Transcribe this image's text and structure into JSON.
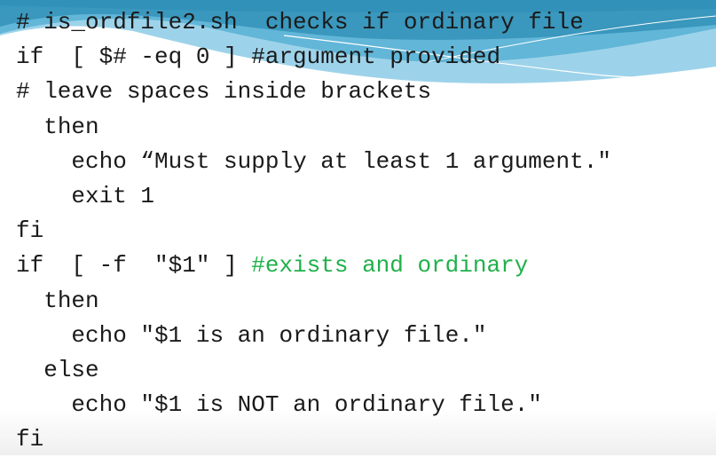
{
  "slide": {
    "accent_colors": {
      "header_dark": "#3191b8",
      "header_mid": "#5fb3d6",
      "header_light": "#9dd3ea",
      "comment_green": "#1fb14a"
    },
    "code_lines": [
      {
        "indent": "",
        "text": "# is_ordfile2.sh  checks if ordinary file",
        "comment": ""
      },
      {
        "indent": "",
        "text": "if  [ $# -eq 0 ] #argument provided",
        "comment": ""
      },
      {
        "indent": "",
        "text": "# leave spaces inside brackets",
        "comment": ""
      },
      {
        "indent": "  ",
        "text": "then",
        "comment": ""
      },
      {
        "indent": "    ",
        "text": "echo “Must supply at least 1 argument.\"",
        "comment": ""
      },
      {
        "indent": "    ",
        "text": "exit 1",
        "comment": ""
      },
      {
        "indent": "",
        "text": "fi",
        "comment": ""
      },
      {
        "indent": "",
        "text": "if  [ -f  \"$1\" ] ",
        "comment": "#exists and ordinary"
      },
      {
        "indent": "  ",
        "text": "then",
        "comment": ""
      },
      {
        "indent": "    ",
        "text": "echo \"$1 is an ordinary file.\"",
        "comment": ""
      },
      {
        "indent": "  ",
        "text": "else",
        "comment": ""
      },
      {
        "indent": "    ",
        "text": "echo \"$1 is NOT an ordinary file.\"",
        "comment": ""
      },
      {
        "indent": "",
        "text": "fi",
        "comment": ""
      }
    ]
  }
}
